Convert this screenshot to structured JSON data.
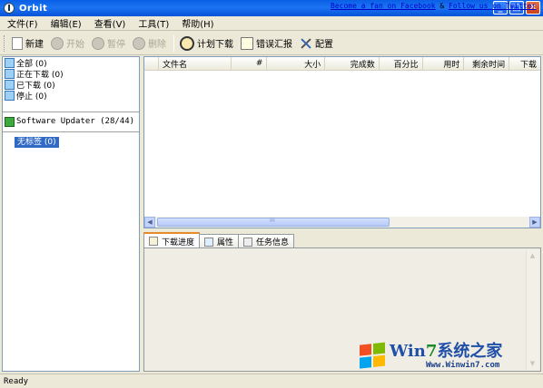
{
  "window": {
    "title": "Orbit",
    "controls": {
      "minimize": "_",
      "maximize": "□",
      "close": "✕"
    }
  },
  "menu": [
    "文件(F)",
    "编辑(E)",
    "查看(V)",
    "工具(T)",
    "帮助(H)"
  ],
  "toolbar": {
    "new": "新建",
    "start": "开始",
    "pause": "暂停",
    "delete": "删除",
    "schedule": "计划下载",
    "error_report": "错误汇报",
    "config": "配置"
  },
  "categories": [
    {
      "label": "全部 (0)"
    },
    {
      "label": "正在下载 (0)"
    },
    {
      "label": "已下载 (0)"
    },
    {
      "label": "停止 (0)"
    }
  ],
  "updater": {
    "label": "Software Updater (28/44)"
  },
  "tags": {
    "untagged": "无标签 (0)"
  },
  "columns": [
    "文件名",
    "#",
    "大小",
    "完成数",
    "百分比",
    "用时",
    "剩余时间",
    "下载"
  ],
  "tabs": [
    "下载进度",
    "属性",
    "任务信息"
  ],
  "status": {
    "text": "Ready",
    "link1": "Become a fan on Facebook",
    "separator": " & ",
    "link2": "Follow us on Twitter"
  },
  "watermark": {
    "brand_a": "Win",
    "brand_b": "7",
    "brand_c": "系统之家",
    "url": "Www.Winwin7.com"
  }
}
